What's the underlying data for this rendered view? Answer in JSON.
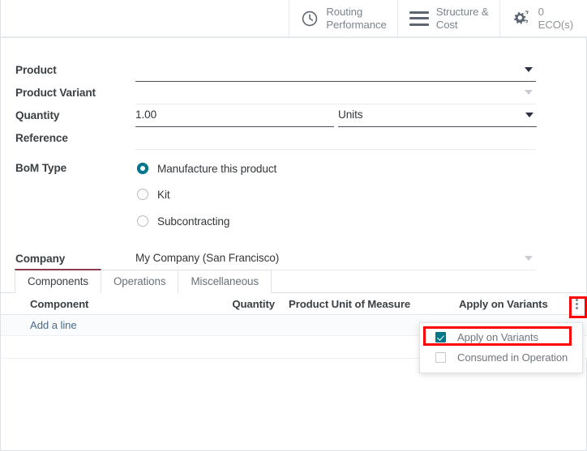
{
  "statbar": {
    "buttons": [
      {
        "icon": "clock-icon",
        "label": "Routing\nPerformance"
      },
      {
        "icon": "list-icon",
        "label": "Structure &\nCost"
      },
      {
        "icon": "gears-icon",
        "count": "0",
        "label": "ECO(s)"
      }
    ]
  },
  "form": {
    "product": {
      "label": "Product",
      "value": "",
      "placeholder": ""
    },
    "product_variant": {
      "label": "Product Variant",
      "value": "",
      "placeholder": ""
    },
    "quantity": {
      "label": "Quantity",
      "value": "1.00",
      "uom": "Units"
    },
    "reference": {
      "label": "Reference",
      "value": "",
      "placeholder": ""
    },
    "bom_type": {
      "label": "BoM Type",
      "options": [
        {
          "label": "Manufacture this product",
          "selected": true
        },
        {
          "label": "Kit",
          "selected": false
        },
        {
          "label": "Subcontracting",
          "selected": false
        }
      ]
    },
    "company": {
      "label": "Company",
      "value": "My Company (San Francisco)"
    }
  },
  "notebook": {
    "tabs": [
      {
        "label": "Components",
        "active": true
      },
      {
        "label": "Operations",
        "active": false
      },
      {
        "label": "Miscellaneous",
        "active": false
      }
    ],
    "table": {
      "headers": {
        "component": "Component",
        "quantity": "Quantity",
        "uom": "Product Unit of Measure",
        "variants": "Apply on Variants"
      },
      "add_line": "Add a line",
      "options_icon": "kebab-menu-icon"
    }
  },
  "dropdown": {
    "items": [
      {
        "label": "Apply on Variants",
        "checked": true
      },
      {
        "label": "Consumed in Operation",
        "checked": false
      }
    ]
  },
  "colors": {
    "accent_teal": "#00788a",
    "tab_active_border": "#8f3a4e",
    "highlight_red": "#ff0000",
    "link_blue": "#4a6b8a"
  }
}
